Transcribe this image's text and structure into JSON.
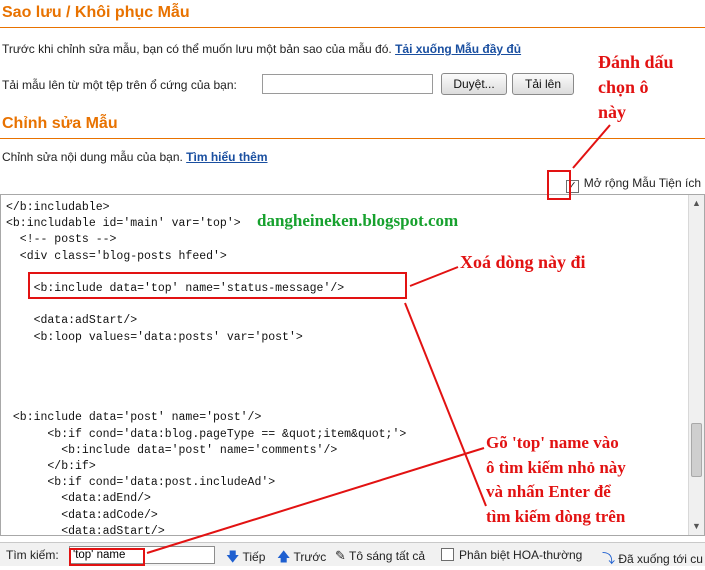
{
  "backup": {
    "title": "Sao lưu / Khôi phục Mẫu",
    "desc": "Trước khi chỉnh sửa mẫu, bạn có thể muốn lưu một bản sao của mẫu đó.",
    "download_link": "Tải xuống Mẫu đầy đủ",
    "upload_label": "Tải mẫu lên từ một tệp trên ổ cứng của bạn:",
    "upload_value": "",
    "browse_button": "Duyệt...",
    "upload_button": "Tải lên"
  },
  "edit": {
    "title": "Chỉnh sửa Mẫu",
    "desc": "Chỉnh sửa nội dung mẫu của bạn.",
    "learn_more": "Tìm hiểu thêm",
    "expand_widgets_label": "Mở rộng Mẫu Tiện ích",
    "expand_widgets_checked": true
  },
  "code_lines": [
    "</b:includable>",
    "<b:includable id='main' var='top'>",
    "  <!-- posts -->",
    "  <div class='blog-posts hfeed'>",
    "",
    "    <b:include data='top' name='status-message'/>",
    "",
    "    <data:adStart/>",
    "    <b:loop values='data:posts' var='post'>",
    "",
    "",
    "",
    "",
    " <b:include data='post' name='post'/>",
    "      <b:if cond='data:blog.pageType == &quot;item&quot;'>",
    "        <b:include data='post' name='comments'/>",
    "      </b:if>",
    "      <b:if cond='data:post.includeAd'>",
    "        <data:adEnd/>",
    "        <data:adCode/>",
    "        <data:adStart/>"
  ],
  "find_bar": {
    "label": "Tìm kiếm:",
    "query": "'top' name",
    "next": "Tiếp",
    "previous": "Trước",
    "highlight_all": "Tô sáng tất cả",
    "match_case": "Phân biệt HOA-thường",
    "status": "Đã xuống tới cu"
  },
  "annotations": {
    "check_note": [
      "Đánh dấu",
      "chọn ô",
      "này"
    ],
    "delete_note": "Xoá dòng này đi",
    "search_note": [
      "Gõ 'top' name vào",
      "ô tìm kiếm nhỏ này",
      "và nhấn Enter để",
      "tìm kiếm dòng trên"
    ],
    "watermark": "dangheineken.blogspot.com"
  },
  "colors": {
    "section_title": "#e87200",
    "link": "#1a4fa0",
    "annotation": "#e21212",
    "watermark": "#17a12e"
  },
  "icons": {
    "next": "arrow-down-icon",
    "previous": "arrow-up-icon",
    "highlight": "highlighter-icon",
    "status": "wrap-icon"
  }
}
